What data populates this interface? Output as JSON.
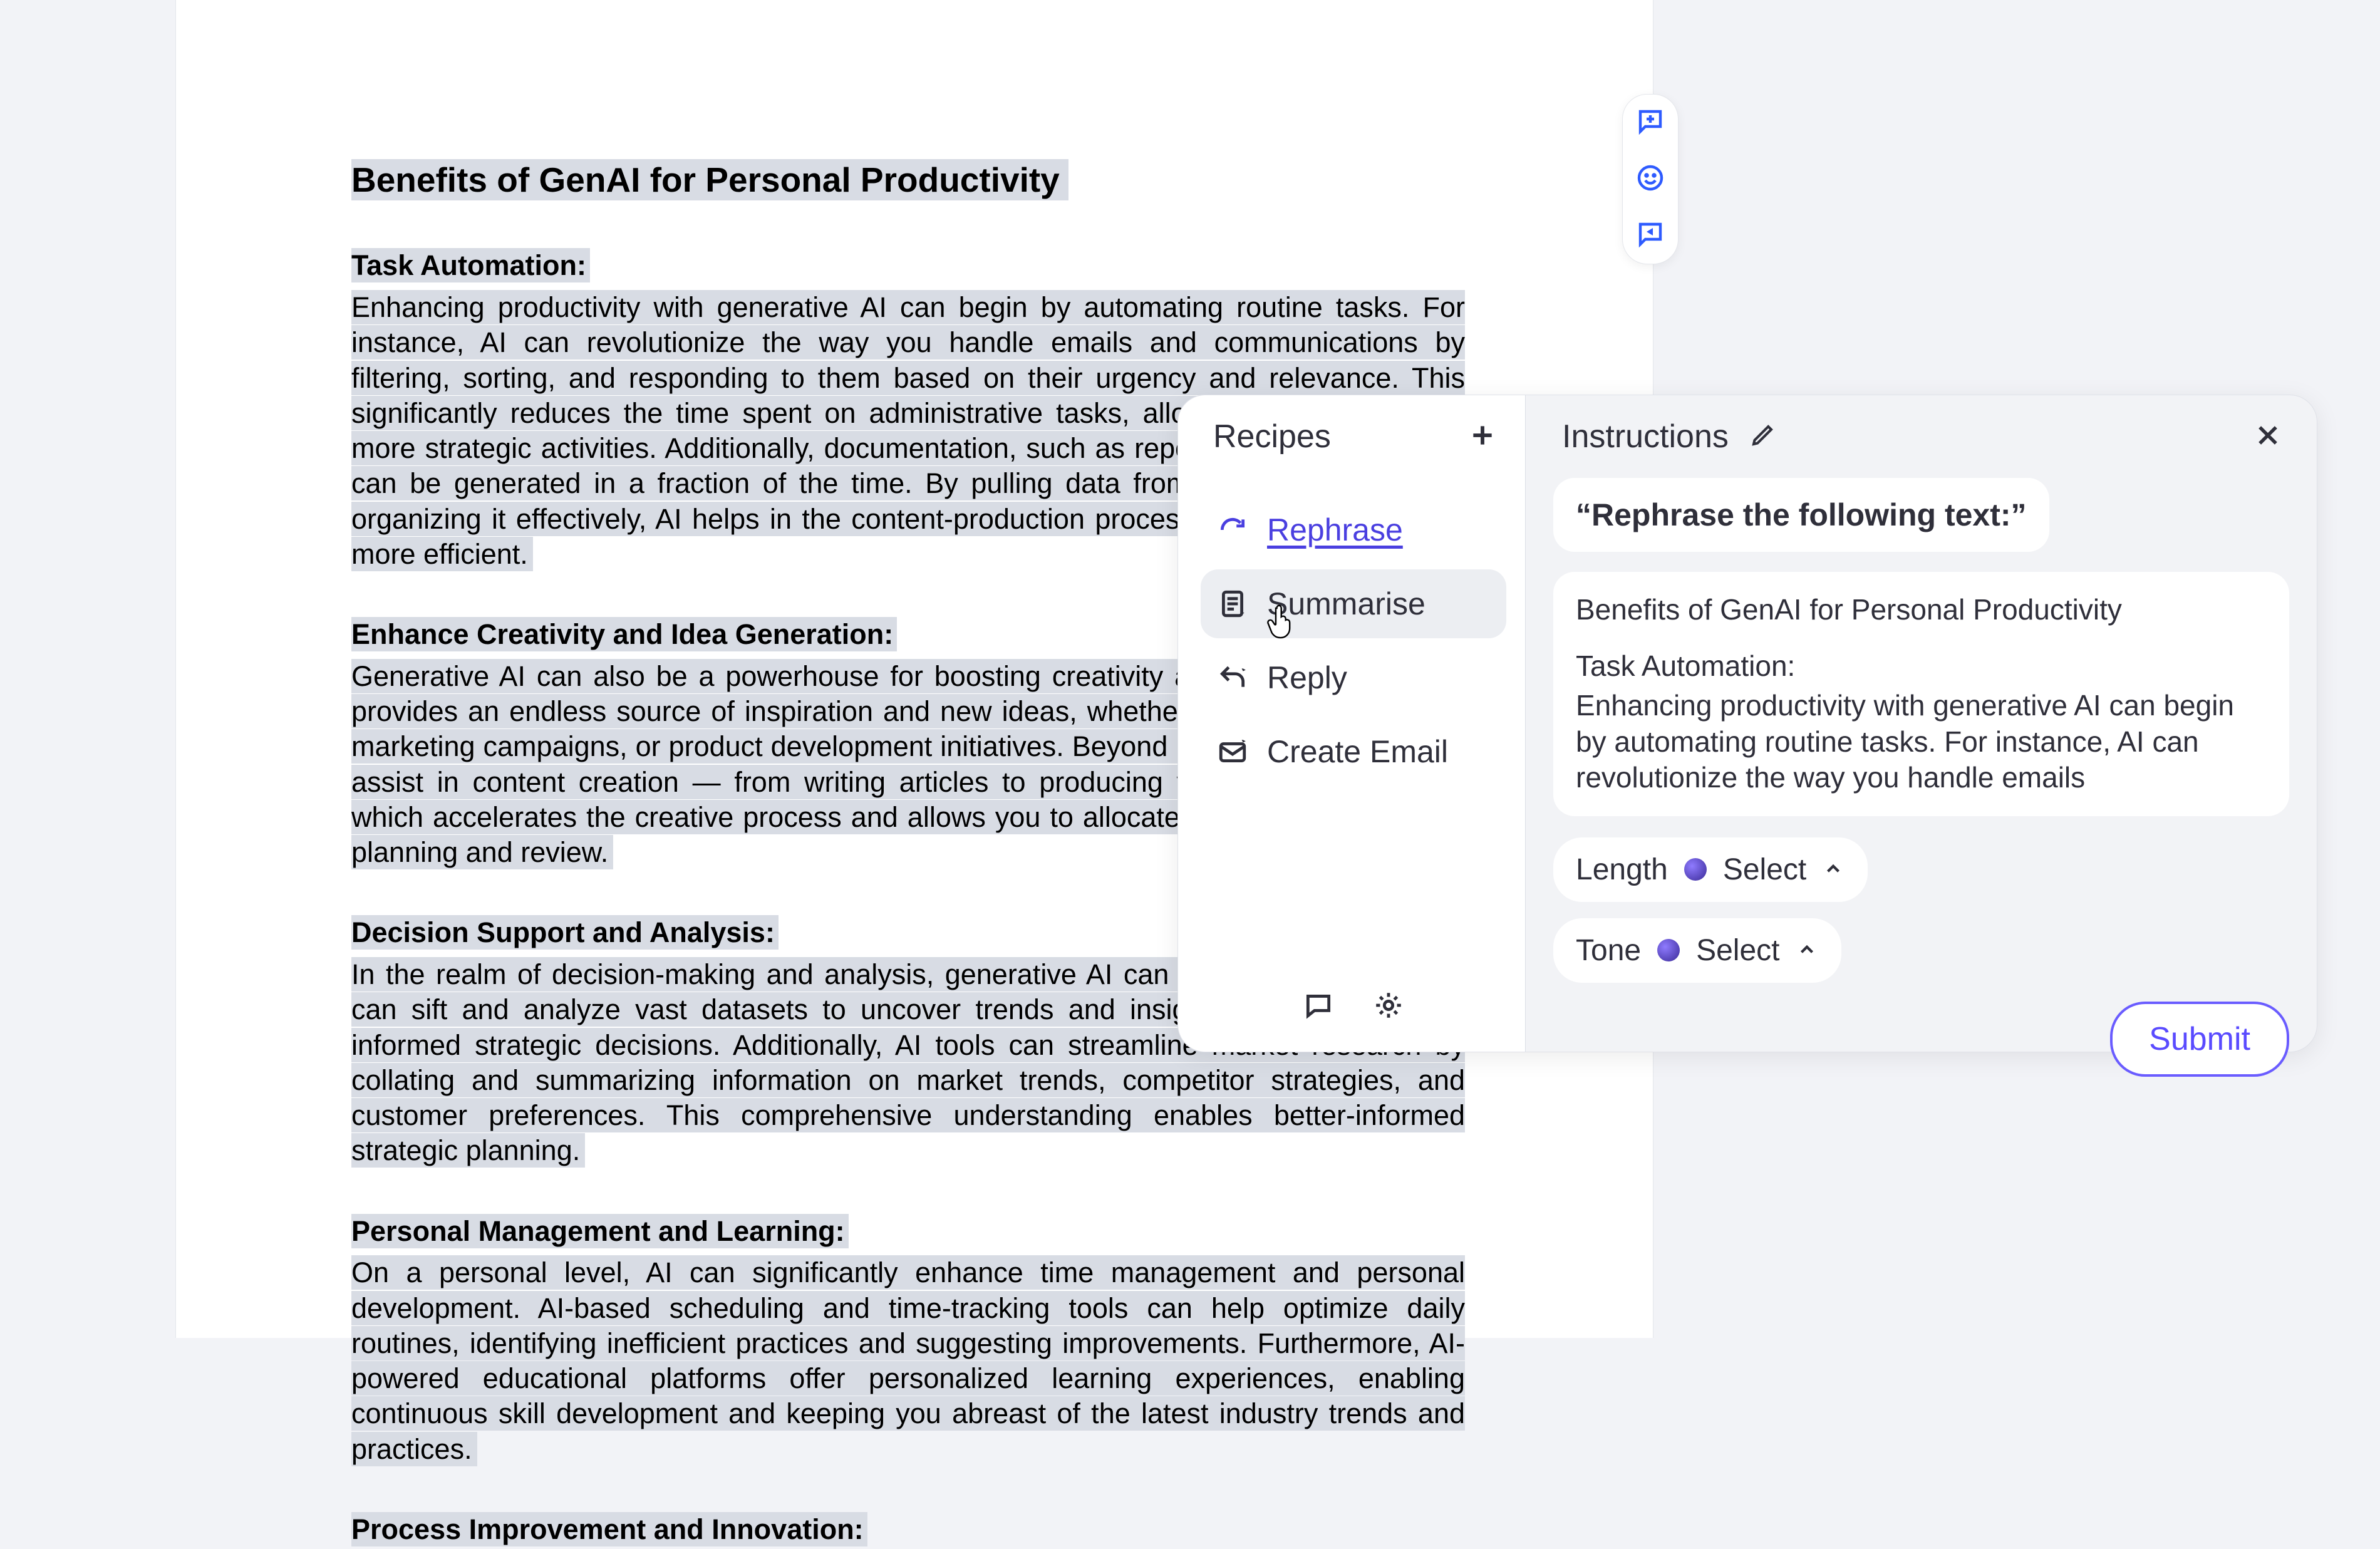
{
  "document": {
    "title": "Benefits of GenAI for Personal Productivity",
    "sections": [
      {
        "heading": "Task Automation:",
        "body": "Enhancing productivity with generative AI can begin by automating routine tasks. For instance, AI can revolutionize the way you handle emails and communications by filtering, sorting, and responding to them based on their urgency and relevance. This significantly reduces the time spent on administrative tasks, allowing you to focus on more strategic activities. Additionally, documentation, such as reports and presentations, can be generated in a fraction of the time. By pulling data from various sources and organizing it effectively, AI helps in the content-production process, making it faster and more efficient."
      },
      {
        "heading": "Enhance Creativity and Idea Generation:",
        "body": "Generative AI can also be a powerhouse for boosting creativity and idea generation. It provides an endless source of inspiration and new ideas, whether for project proposals, marketing campaigns, or product development initiatives. Beyond idea generation, AI can assist in content creation — from writing articles to producing videos and images — which accelerates the creative process and allows you to allocate more time to strategic planning and review."
      },
      {
        "heading": "Decision Support and Analysis:",
        "body": "In the realm of decision-making and analysis, generative AI can be a game changer. It can sift and analyze vast datasets to uncover trends and insights, aiding in making informed strategic decisions. Additionally, AI tools can streamline market research by collating and summarizing information on market trends, competitor strategies, and customer preferences. This comprehensive understanding enables better-informed strategic planning."
      },
      {
        "heading": "Personal Management and Learning:",
        "body": "On a personal level, AI can significantly enhance time management and personal development. AI-based scheduling and time-tracking tools can help optimize daily routines, identifying inefficient practices and suggesting improvements. Furthermore, AI-powered educational platforms offer personalized learning experiences, enabling continuous skill development and keeping you abreast of the latest industry trends and practices."
      },
      {
        "heading": "Process Improvement and Innovation:",
        "body": ""
      }
    ]
  },
  "float_tools": {
    "add_comment": "Add comment",
    "emoji": "Add reaction",
    "suggest": "Suggest edit"
  },
  "popup": {
    "recipes_title": "Recipes",
    "recipes": [
      {
        "id": "rephrase",
        "label": "Rephrase",
        "icon": "refresh-icon",
        "active": true
      },
      {
        "id": "summarise",
        "label": "Summarise",
        "icon": "doc-sparkle-icon",
        "hovered": true
      },
      {
        "id": "reply",
        "label": "Reply",
        "icon": "reply-sparkle-icon"
      },
      {
        "id": "create_email",
        "label": "Create Email",
        "icon": "mail-sparkle-icon"
      }
    ],
    "instructions_title": "Instructions",
    "prompt": "“Rephrase the following text:”",
    "context_title": "Benefits of GenAI for Personal Productivity",
    "context_sec_head": "Task Automation:",
    "context_body": "Enhancing productivity with generative AI can begin by automating routine tasks. For instance, AI can revolutionize the way you handle emails",
    "length_label": "Length",
    "length_value": "Select",
    "tone_label": "Tone",
    "tone_value": "Select",
    "submit_label": "Submit"
  }
}
